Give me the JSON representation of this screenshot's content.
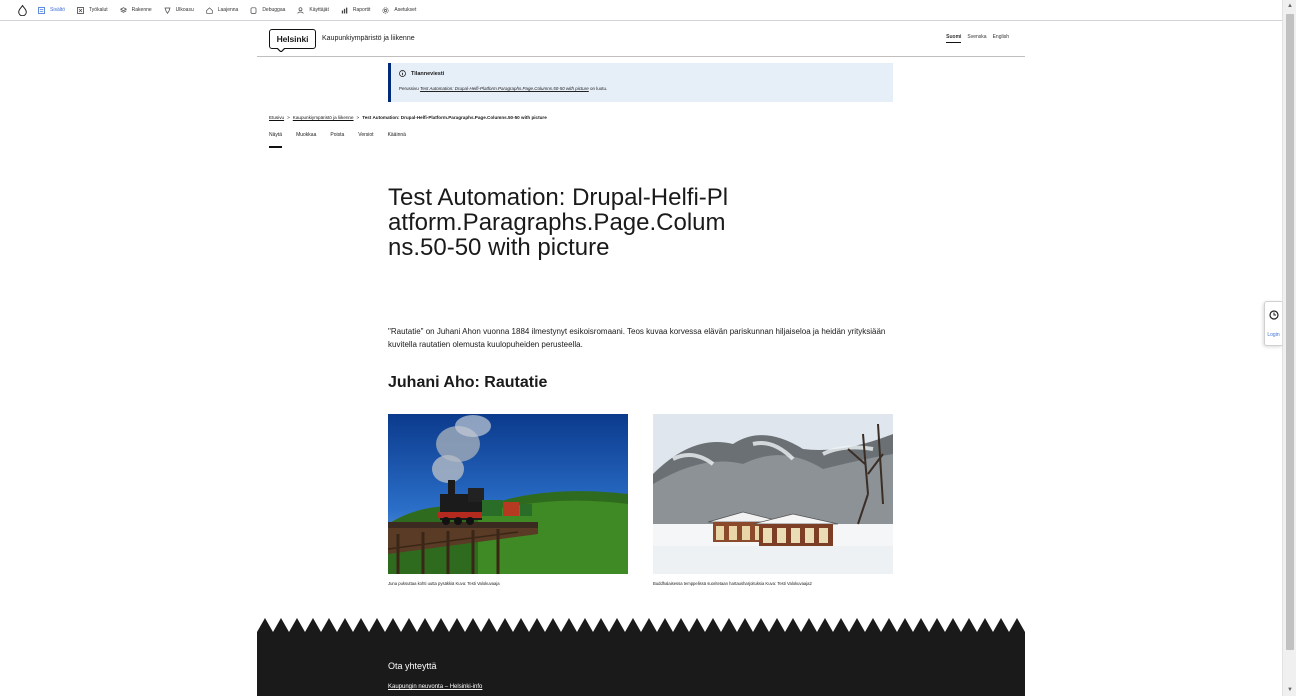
{
  "toolbar": {
    "items": [
      {
        "label": "Sisältö",
        "icon": "content-icon"
      },
      {
        "label": "Työkalut",
        "icon": "tools-icon"
      },
      {
        "label": "Rakenne",
        "icon": "structure-icon"
      },
      {
        "label": "Ulkoasu",
        "icon": "appearance-icon"
      },
      {
        "label": "Laajenna",
        "icon": "extend-icon"
      },
      {
        "label": "Debuggaa",
        "icon": "debug-icon"
      },
      {
        "label": "Käyttäjät",
        "icon": "users-icon"
      },
      {
        "label": "Raportit",
        "icon": "reports-icon"
      },
      {
        "label": "Asetukset",
        "icon": "settings-icon"
      }
    ]
  },
  "side_tab": {
    "label": "Login"
  },
  "header": {
    "logo": "Helsinki",
    "site_name": "Kaupunkiympäristö ja liikenne",
    "languages": [
      "Suomi",
      "Svenska",
      "English"
    ]
  },
  "status": {
    "title": "Tilanneviesti",
    "prefix": "Perussivu",
    "link": "Test Automation: Drupal-Helfi-Platform.Paragraphs.Page.Columns.50-50 with picture",
    "suffix": "on luotu."
  },
  "breadcrumb": {
    "home": "Etusivu",
    "parent": "Kaupunkiympäristö ja liikenne",
    "current": "Test Automation: Drupal-Helfi-Platform.Paragraphs.Page.Columns.50-50 with picture",
    "sep": ">"
  },
  "tabs": [
    "Näytä",
    "Muokkaa",
    "Poista",
    "Versiot",
    "Kääinnä"
  ],
  "main": {
    "title": "Test Automation: Drupal-Helfi-Platform.Paragraphs.Page.Columns.50-50 with picture",
    "lead": "\"Rautatie\" on Juhani Ahon vuonna 1884 ilmestynyt esikoisromaani. Teos kuvaa korvessa elävän pariskunnan hiljaiseloa ja heidän yrityksiään kuvitella rautatien olemusta kuulopuheiden perusteella.",
    "subtitle": "Juhani Aho: Rautatie",
    "captions": [
      "Juna puksuttaa kohti uutta pysäkkiä Kuva: Testi Valokuvaaja",
      "Buddhalaisessa temppelissä suoritetaan hartausharjoituksia Kuva: Testi Valokuvaaja2"
    ]
  },
  "footer": {
    "title": "Ota yhteyttä",
    "link": "Kaupungin neuvonta – Helsinki-info"
  },
  "colors": {
    "accent": "#3b6fd6",
    "status_bg": "#e6eef8",
    "status_border": "#002a7a",
    "footer_bg": "#1a1a1a"
  }
}
